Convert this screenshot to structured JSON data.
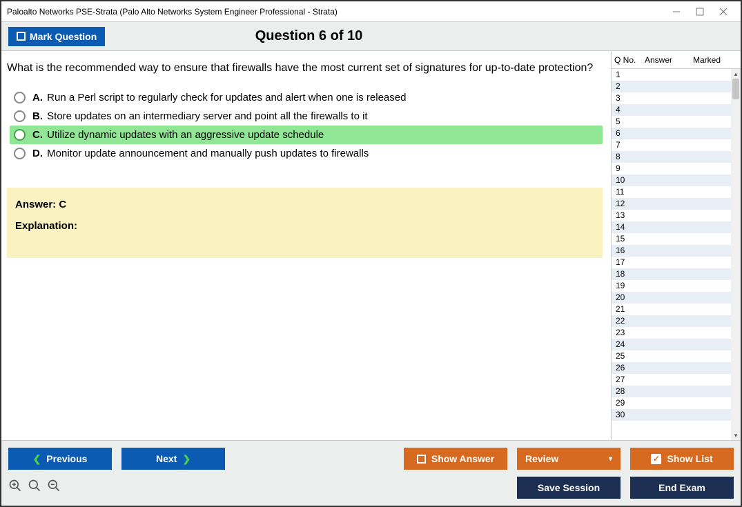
{
  "window": {
    "title": "Paloalto Networks PSE-Strata (Palo Alto Networks System Engineer Professional - Strata)"
  },
  "topbar": {
    "mark_label": "Mark Question",
    "question_heading": "Question 6 of 10"
  },
  "question": {
    "text": "What is the recommended way to ensure that firewalls have the most current set of signatures for up-to-date protection?",
    "options": [
      {
        "letter": "A.",
        "text": "Run a Perl script to regularly check for updates and alert when one is released",
        "selected": false
      },
      {
        "letter": "B.",
        "text": "Store updates on an intermediary server and point all the firewalls to it",
        "selected": false
      },
      {
        "letter": "C.",
        "text": "Utilize dynamic updates with an aggressive update schedule",
        "selected": true
      },
      {
        "letter": "D.",
        "text": "Monitor update announcement and manually push updates to firewalls",
        "selected": false
      }
    ]
  },
  "answer_panel": {
    "answer_label": "Answer: C",
    "explanation_label": "Explanation:"
  },
  "sidepanel": {
    "headers": {
      "qno": "Q No.",
      "answer": "Answer",
      "marked": "Marked"
    },
    "rows": [
      1,
      2,
      3,
      4,
      5,
      6,
      7,
      8,
      9,
      10,
      11,
      12,
      13,
      14,
      15,
      16,
      17,
      18,
      19,
      20,
      21,
      22,
      23,
      24,
      25,
      26,
      27,
      28,
      29,
      30
    ]
  },
  "footer": {
    "previous": "Previous",
    "next": "Next",
    "show_answer": "Show Answer",
    "review": "Review",
    "show_list": "Show List",
    "save_session": "Save Session",
    "end_exam": "End Exam"
  }
}
